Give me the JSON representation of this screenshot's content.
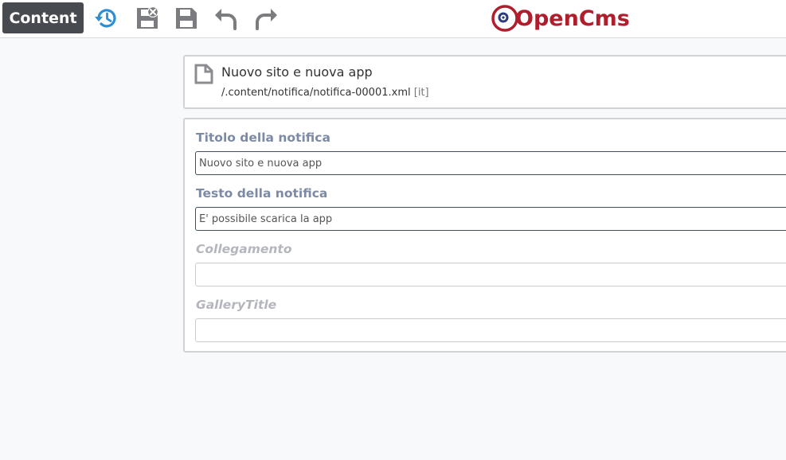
{
  "toolbar": {
    "content_button": "Content",
    "icons": [
      "history-icon",
      "save-exit-icon",
      "save-icon",
      "undo-icon",
      "redo-icon"
    ],
    "colors": {
      "history": "#2c8fd1",
      "gray": "#7a7c80"
    }
  },
  "logo": {
    "text": "OpenCms",
    "color": "#b01e2d"
  },
  "resource": {
    "title": "Nuovo sito e nuova app",
    "path": "/.content/notifica/notifica-00001.xml",
    "locale": "[it]"
  },
  "form": {
    "fields": [
      {
        "label": "Titolo della notifica",
        "value": "Nuovo sito e nuova app"
      },
      {
        "label": "Testo della notifica",
        "value": "E' possibile scarica la app"
      },
      {
        "label": "Collegamento",
        "value": ""
      },
      {
        "label": "GalleryTitle",
        "value": ""
      }
    ]
  }
}
